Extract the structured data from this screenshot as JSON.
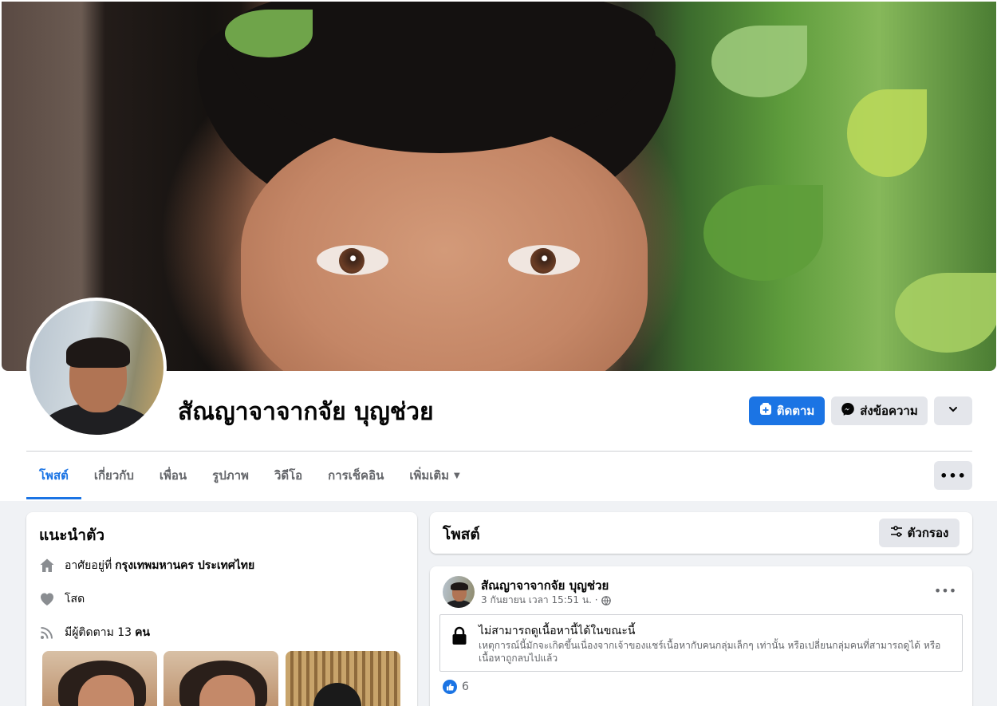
{
  "profile": {
    "name": "สัณญาจาจากจัย บุญช่วย"
  },
  "actions": {
    "follow_label": "ติดตาม",
    "message_label": "ส่งข้อความ"
  },
  "tabs": [
    {
      "label": "โพสต์",
      "active": true
    },
    {
      "label": "เกี่ยวกับ",
      "active": false
    },
    {
      "label": "เพื่อน",
      "active": false
    },
    {
      "label": "รูปภาพ",
      "active": false
    },
    {
      "label": "วิดีโอ",
      "active": false
    },
    {
      "label": "การเช็คอิน",
      "active": false
    },
    {
      "label": "เพิ่มเติม",
      "active": false
    }
  ],
  "intro": {
    "title": "แนะนำตัว",
    "lives_prefix": "อาศัยอยู่ที่",
    "lives_place": "กรุงเทพมหานคร ประเทศไทย",
    "relationship": "โสด",
    "followers_prefix": "มีผู้ติดตาม 13",
    "followers_suffix": "คน"
  },
  "posts": {
    "title": "โพสต์",
    "filter_label": "ตัวกรอง"
  },
  "post": {
    "author": "สัณญาจาจากจัย บุญช่วย",
    "timestamp": "3 กันยายน เวลา 15:51 น. ·",
    "notice_title": "ไม่สามารถดูเนื้อหานี้ได้ในขณะนี้",
    "notice_desc": "เหตุการณ์นี้มักจะเกิดขึ้นเนื่องจากเจ้าของแชร์เนื้อหากับคนกลุ่มเล็กๆ เท่านั้น หรือเปลี่ยนกลุ่มคนที่สามารถดูได้ หรือเนื้อหาถูกลบไปแล้ว",
    "like_count": "6"
  },
  "colors": {
    "accent": "#1b74e4",
    "button_grey": "#e4e6eb",
    "background": "#f0f2f5"
  }
}
